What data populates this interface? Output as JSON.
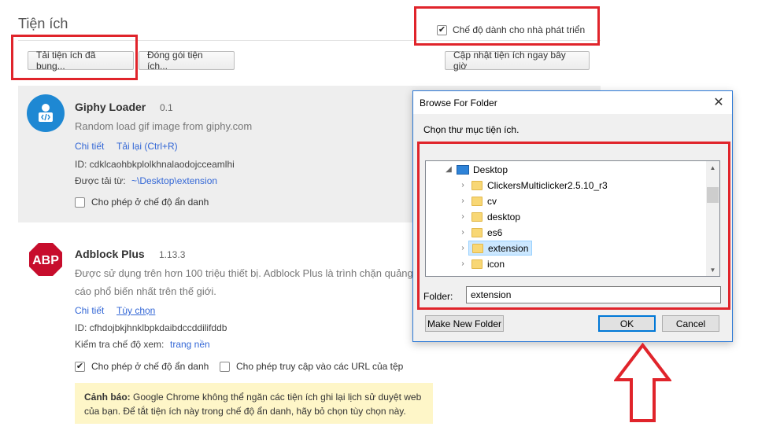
{
  "page": {
    "title": "Tiện ích",
    "developer_mode_label": "Chế độ dành cho nhà phát triển",
    "developer_mode_checked": true
  },
  "toolbar": {
    "load_unpacked_label": "Tải tiện ích đã bung...",
    "pack_label": "Đóng gói tiện ích...",
    "update_label": "Cập nhật tiện ích ngay bây giờ"
  },
  "extensions": [
    {
      "name": "Giphy Loader",
      "version": "0.1",
      "description": "Random load gif image from giphy.com",
      "details_link": "Chi tiết",
      "reload_link": "Tải lại (Ctrl+R)",
      "id_label": "ID: cdklcaohbkplolkhnalaodojcceamlhi",
      "loaded_from_label": "Được tải từ:",
      "loaded_from_path": "~\\Desktop\\extension",
      "incognito_label": "Cho phép ở chế độ ẩn danh",
      "incognito_checked": false
    },
    {
      "name": "Adblock Plus",
      "version": "1.13.3",
      "description_line1": "Được sử dụng trên hơn 100 triệu thiết bị. Adblock Plus là trình chặn quảng",
      "description_line2": "cáo phổ biến nhất trên thế giới.",
      "details_link": "Chi tiết",
      "options_link": "Tùy chọn",
      "id_label": "ID: cfhdojbkjhnklbpkdaibdccddilifddb",
      "inspect_label": "Kiểm tra chế độ xem:",
      "inspect_link": "trang nền",
      "incognito_label": "Cho phép ở chế độ ẩn danh",
      "incognito_checked": true,
      "file_url_label": "Cho phép truy cập vào các URL của tệp",
      "file_url_checked": false,
      "icon_text": "ABP"
    }
  ],
  "warning": {
    "bold": "Cảnh báo:",
    "text_line1": "Google Chrome không thể ngăn các tiện ích ghi lại lịch sử duyệt web",
    "text_line2": "của bạn. Để tắt tiện ích này trong chế độ ẩn danh, hãy bỏ chọn tùy chọn này."
  },
  "dialog": {
    "title": "Browse For Folder",
    "close_glyph": "✕",
    "instruction": "Chọn thư mục tiện ích.",
    "tree": {
      "root": "Desktop",
      "items": [
        "ClickersMulticlicker2.5.10_r3",
        "cv",
        "desktop",
        "es6",
        "extension",
        "icon"
      ],
      "selected": "extension"
    },
    "folder_label": "Folder:",
    "folder_value": "extension",
    "new_folder_label": "Make New Folder",
    "ok_label": "OK",
    "cancel_label": "Cancel"
  },
  "colors": {
    "highlight_red": "#e0242b",
    "link_blue": "#3367d6",
    "warning_bg": "#fef6c8",
    "dialog_border": "#2b78d6"
  },
  "icons": [
    "checkmark-icon",
    "giphy-logo-icon",
    "abp-logo-icon",
    "folder-icon",
    "desktop-icon",
    "chevron-right-icon",
    "chevron-down-icon",
    "close-icon",
    "up-arrow-annotation"
  ]
}
